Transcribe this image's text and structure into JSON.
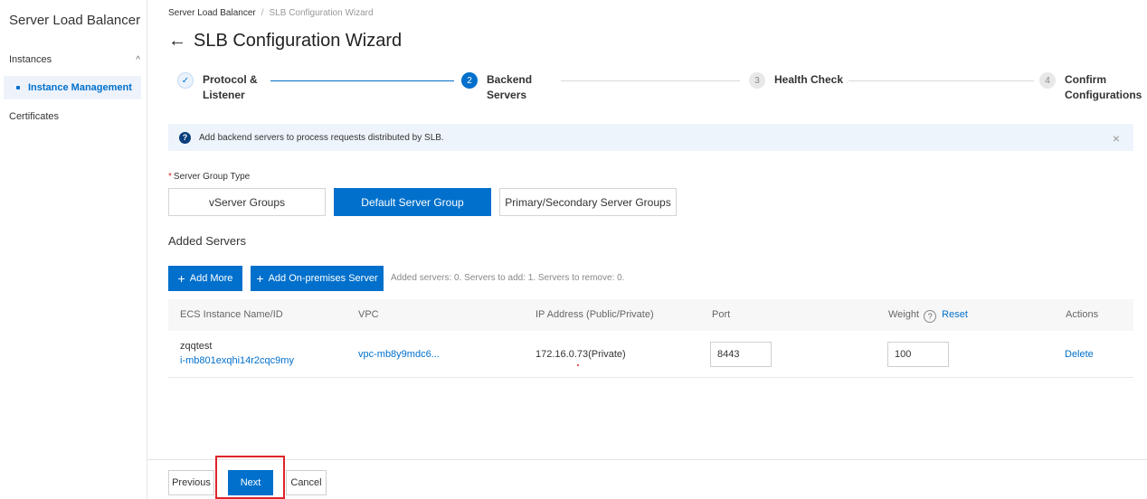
{
  "sidebar": {
    "title": "Server Load Balancer",
    "group_label": "Instances",
    "group_chevron": "^",
    "active_item": "Instance Management",
    "item_certificates": "Certificates"
  },
  "breadcrumb": {
    "root": "Server Load Balancer",
    "separator": "/",
    "current": "SLB Configuration Wizard"
  },
  "page": {
    "back_glyph": "←",
    "title": "SLB Configuration Wizard"
  },
  "steps": [
    {
      "number": "✓",
      "line1": "Protocol &",
      "line2": "Listener",
      "state": "done"
    },
    {
      "number": "2",
      "line1": "Backend",
      "line2": "Servers",
      "state": "active"
    },
    {
      "number": "3",
      "line1": "Health Check",
      "line2": "",
      "state": "todo"
    },
    {
      "number": "4",
      "line1": "Confirm",
      "line2": "Configurations",
      "state": "todo"
    }
  ],
  "banner": {
    "icon": "?",
    "text": "Add backend servers to process requests distributed by SLB.",
    "close": "×"
  },
  "server_group": {
    "required_mark": "*",
    "label": "Server Group Type",
    "options": [
      "vServer Groups",
      "Default Server Group",
      "Primary/Secondary Server Groups"
    ],
    "selected": "Default Server Group"
  },
  "added_servers": {
    "title": "Added Servers",
    "add_more": "Add More",
    "add_onprem": "Add On-premises Server",
    "plus": "+",
    "summary": "Added servers: 0. Servers to add: 1. Servers to remove: 0."
  },
  "table": {
    "headers": {
      "instance": "ECS Instance Name/ID",
      "vpc": "VPC",
      "ip": "IP Address (Public/Private)",
      "port": "Port",
      "weight": "Weight",
      "weight_help": "?",
      "reset": "Reset",
      "actions": "Actions"
    },
    "rows": [
      {
        "name": "zqqtest",
        "id": "i-mb801exqhi14r2cqc9my",
        "vpc": "vpc-mb8y9mdc6...",
        "ip": "172.16.0.73(Private)",
        "port": "8443",
        "weight": "100",
        "action": "Delete"
      }
    ]
  },
  "footer": {
    "previous": "Previous",
    "next": "Next",
    "cancel": "Cancel"
  },
  "colors": {
    "accent": "#0070cc",
    "highlight": "#e0242b"
  }
}
